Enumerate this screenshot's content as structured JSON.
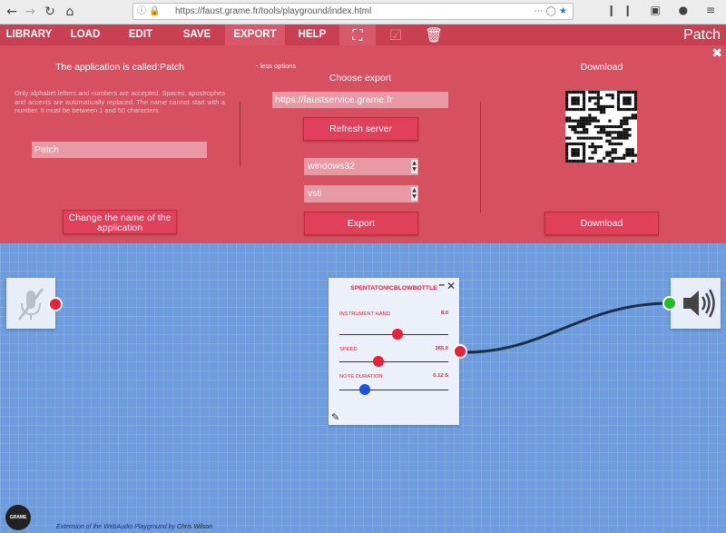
{
  "browser": {
    "url": "https://faust.grame.fr/tools/playground/index.html",
    "back_icon": "back-arrow-icon",
    "forward_icon": "forward-arrow-icon",
    "reload_icon": "reload-icon",
    "home_icon": "home-icon"
  },
  "menu": {
    "items": [
      "LIBRARY",
      "LOAD",
      "EDIT",
      "SAVE",
      "EXPORT",
      "HELP"
    ],
    "active": "EXPORT",
    "app_title": "Patch"
  },
  "export_panel": {
    "name_title": "The application is called:Patch",
    "name_hint": "Only alphabet letters and numbers are accepted. Spaces, apostrophes and accents are automatically replaced. The name cannot start with a number. It must be between 1 and 50 characters.",
    "name_value": "Patch",
    "change_name_button": "Change the name of the application",
    "less_options": "- less options",
    "choose_export_title": "Choose export",
    "server_url": "https://faustservice.grame.fr",
    "refresh_button": "Refresh server",
    "platform_selected": "windows32",
    "architecture_selected": "vsti",
    "export_button": "Export",
    "download_title": "Download",
    "download_button": "Download"
  },
  "module": {
    "title": "SPENTATONICBLOWBOTTLE",
    "params": [
      {
        "label": "INSTRUMENT HAND",
        "value": "8.0",
        "level": 0.53
      },
      {
        "label": "SPEED",
        "value": "365.0",
        "level": 0.36
      },
      {
        "label": "NOTE DURATION",
        "value": "0.12 S",
        "level": 0.23
      }
    ]
  },
  "colors": {
    "accent": "#d6505f",
    "menu": "#c94052",
    "port_red": "#e8203a",
    "port_green": "#22bb22",
    "thumb_blue": "#1e50e0",
    "cable": "#1b2f4a"
  },
  "footer": {
    "text": "Extension of the WebAudio Playground by",
    "author": "Chris Wilson"
  }
}
